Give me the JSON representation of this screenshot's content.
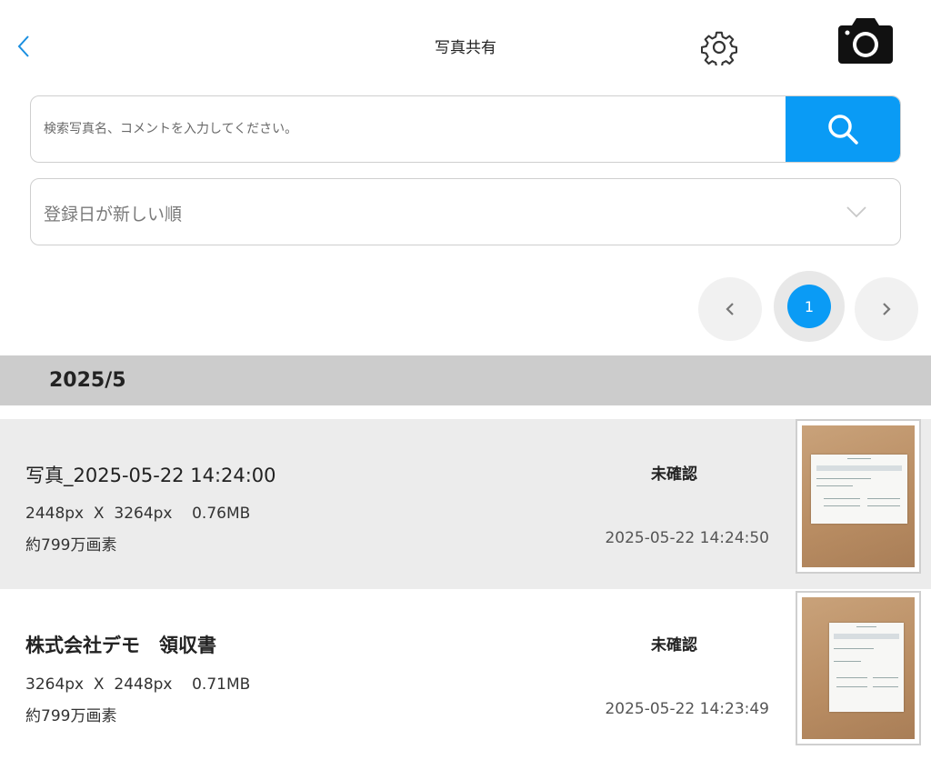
{
  "header": {
    "title": "写真共有",
    "back_icon": "chevron-left-icon",
    "settings_icon": "gear-icon",
    "camera_icon": "camera-icon",
    "accent_color": "#0a9bf5"
  },
  "search": {
    "placeholder": "検索写真名、コメントを入力してください。",
    "value": "",
    "button_icon": "search-icon"
  },
  "sort": {
    "selected": "登録日が新しい順",
    "icon": "chevron-down-icon"
  },
  "pagination": {
    "prev_icon": "chevron-left-icon",
    "current_page": "1",
    "next_icon": "chevron-right-icon"
  },
  "groups": [
    {
      "month": "2025/5",
      "photos": [
        {
          "name": "写真_2025-05-22 14:24:00",
          "dimensions": "2448px  X  3264px    0.76MB",
          "pixels": "約799万画素",
          "status": "未確認",
          "date": "2025-05-22 14:24:50",
          "thumbnail": "receipt-photo-thumbnail"
        },
        {
          "name": "株式会社デモ　領収書",
          "dimensions": "3264px  X  2448px    0.71MB",
          "pixels": "約799万画素",
          "status": "未確認",
          "date": "2025-05-22 14:23:49",
          "thumbnail": "receipt-photo-thumbnail"
        }
      ]
    }
  ]
}
